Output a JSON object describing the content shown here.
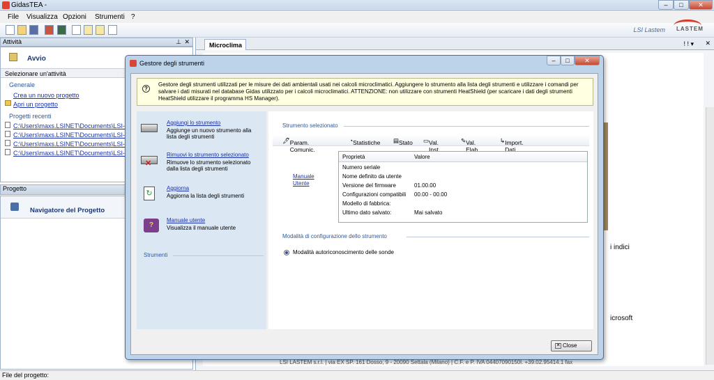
{
  "app": {
    "title": "GidasTEA -",
    "brand": "LSI Lastem",
    "logo_text": "LASTEM"
  },
  "menu": [
    "File",
    "Visualizza",
    "Opzioni",
    "Strumenti",
    "?"
  ],
  "left_panel": {
    "header": "Attività",
    "avvio": "Avvio",
    "select_label": "Selezionare un'attività",
    "general_title": "Generale",
    "new_project": "Crea un nuovo progetto",
    "open_project": "Apri un progetto",
    "recent_title": "Progetti recenti",
    "recent": [
      "C:\\Users\\maxs.LSINET\\Documents\\LSI-Las",
      "C:\\Users\\maxs.LSINET\\Documents\\LSI-Las",
      "C:\\Users\\maxs.LSINET\\Documents\\LSI-Las",
      "C:\\Users\\maxs.LSINET\\Documents\\LSI-Las"
    ]
  },
  "project_panel": {
    "header": "Progetto",
    "navigator": "Navigatore del Progetto"
  },
  "main": {
    "tab": "Microclima",
    "bg_text_1": "i indici",
    "bg_text_2": "icrosoft",
    "footer": "LSI LASTEM s.r.l. | via EX SP. 161 Dosso, 9 - 20090 Settala (Milano) | C.F. e P. IVA 04407090150l. +39.02.95414.1 fax"
  },
  "statusbar": "File del progetto:",
  "dialog": {
    "title": "Gestore degli strumenti",
    "info": "Gestore degli strumenti utilizzati per le misure dei dati ambientali usati nei calcoli microclimatici. Aggiungere lo strumento alla lista degli strumenti e utilizzare i comandi per salvare i dati misurati nel database Gidas utilizzato per i calcoli microclimatici. ATTENZIONE: non utilizzare con strumenti HeatShield (per scaricare i dati degli strumenti HeatShield utilizzare il programma HS Manager).",
    "actions": [
      {
        "link": "Aggiungi lo strumento",
        "desc": "Aggiunge un nuovo strumento alla lista degli strumenti"
      },
      {
        "link": "Rimuovi lo strumento selezionato",
        "desc": "Rimuove lo strumento selezionato dalla lista degli strumenti"
      },
      {
        "link": "Aggiorna",
        "desc": "Aggiorna la lista degli strumenti"
      },
      {
        "link": "Manuale utente",
        "desc": "Visualizza il manuale utente"
      }
    ],
    "instruments_title": "Strumenti",
    "selected_title": "Strumento selezionato",
    "toolbar": [
      "Param. Comunic.",
      "Statistiche",
      "Stato",
      "Val. Inst.",
      "Val. Elab",
      "Import. Dati Binari"
    ],
    "manual_link": "Manuale Utente",
    "grid_headers": [
      "Proprietà",
      "Valore"
    ],
    "grid_rows": [
      [
        "Numero seriale",
        ""
      ],
      [
        "Nome definito da utente",
        ""
      ],
      [
        "Versione del firmware",
        "01.00.00"
      ],
      [
        "Configurazioni compatibili",
        "00.00 - 00.00"
      ],
      [
        "Modello di fabbrica:",
        ""
      ],
      [
        "Ultimo dato salvato:",
        "Mai salvato"
      ]
    ],
    "config_title": "Modalità di configurazione dello strumento",
    "radio_label": "Modalità autoriconoscimento delle sonde",
    "close": "Close"
  }
}
